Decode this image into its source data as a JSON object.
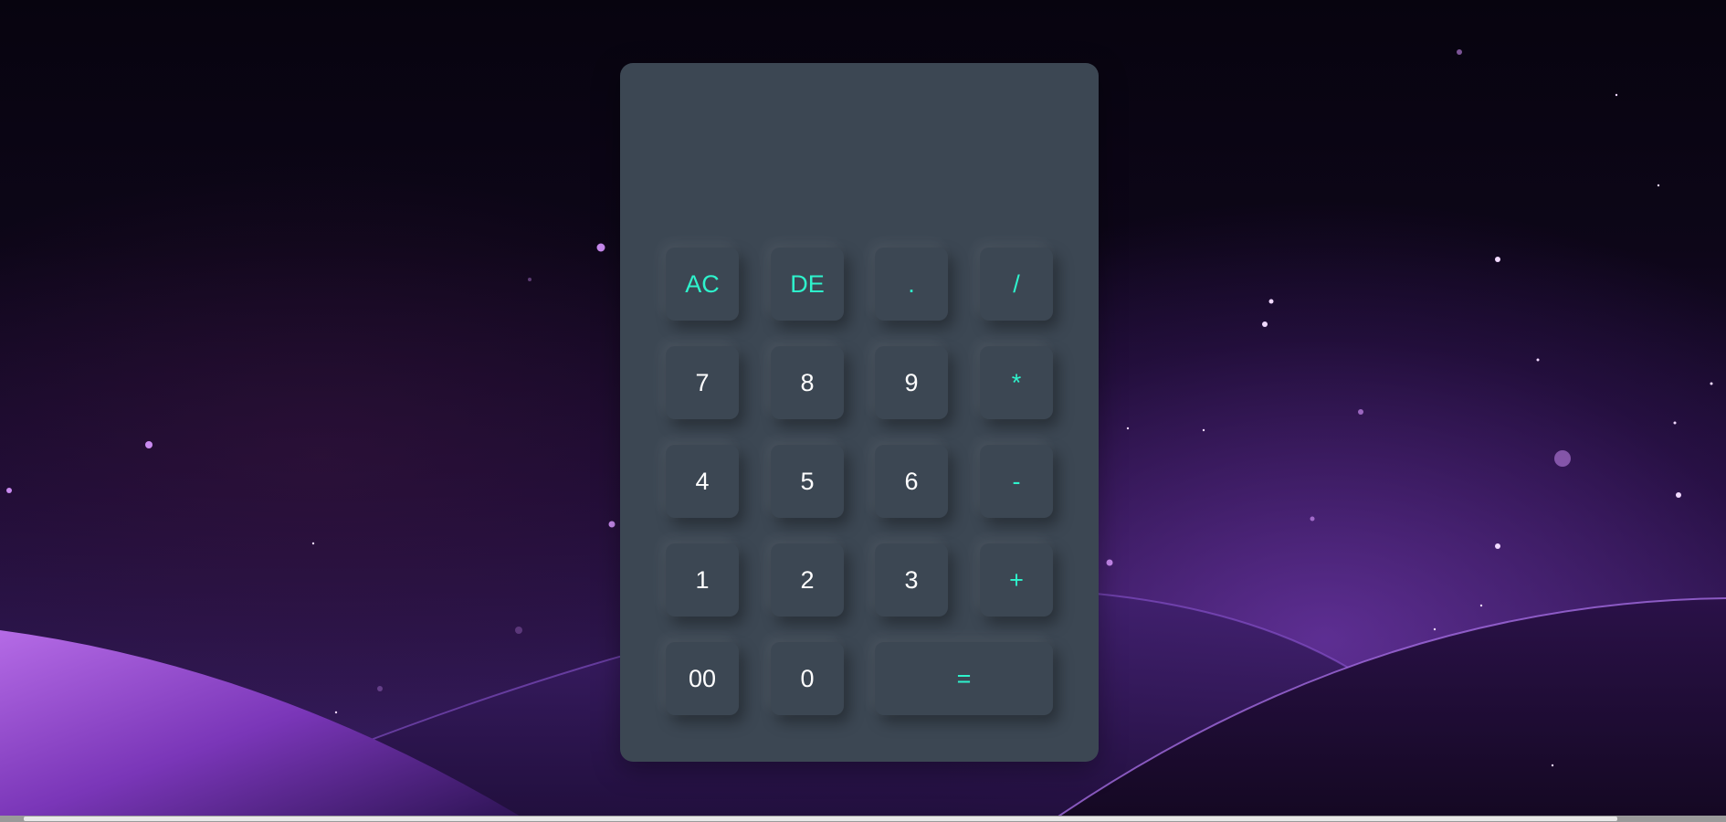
{
  "calculator": {
    "display_value": "",
    "keys": [
      {
        "label": "AC",
        "type": "operator"
      },
      {
        "label": "DE",
        "type": "operator"
      },
      {
        "label": ".",
        "type": "operator"
      },
      {
        "label": "/",
        "type": "operator"
      },
      {
        "label": "7",
        "type": "digit"
      },
      {
        "label": "8",
        "type": "digit"
      },
      {
        "label": "9",
        "type": "digit"
      },
      {
        "label": "*",
        "type": "operator"
      },
      {
        "label": "4",
        "type": "digit"
      },
      {
        "label": "5",
        "type": "digit"
      },
      {
        "label": "6",
        "type": "digit"
      },
      {
        "label": "-",
        "type": "operator"
      },
      {
        "label": "1",
        "type": "digit"
      },
      {
        "label": "2",
        "type": "digit"
      },
      {
        "label": "3",
        "type": "digit"
      },
      {
        "label": "+",
        "type": "operator"
      },
      {
        "label": "00",
        "type": "digit"
      },
      {
        "label": "0",
        "type": "digit"
      },
      {
        "label": "=",
        "type": "operator"
      }
    ]
  },
  "colors": {
    "panel": "#3c4753",
    "operator_text": "#2ef3cc",
    "digit_text": "#ffffff"
  }
}
